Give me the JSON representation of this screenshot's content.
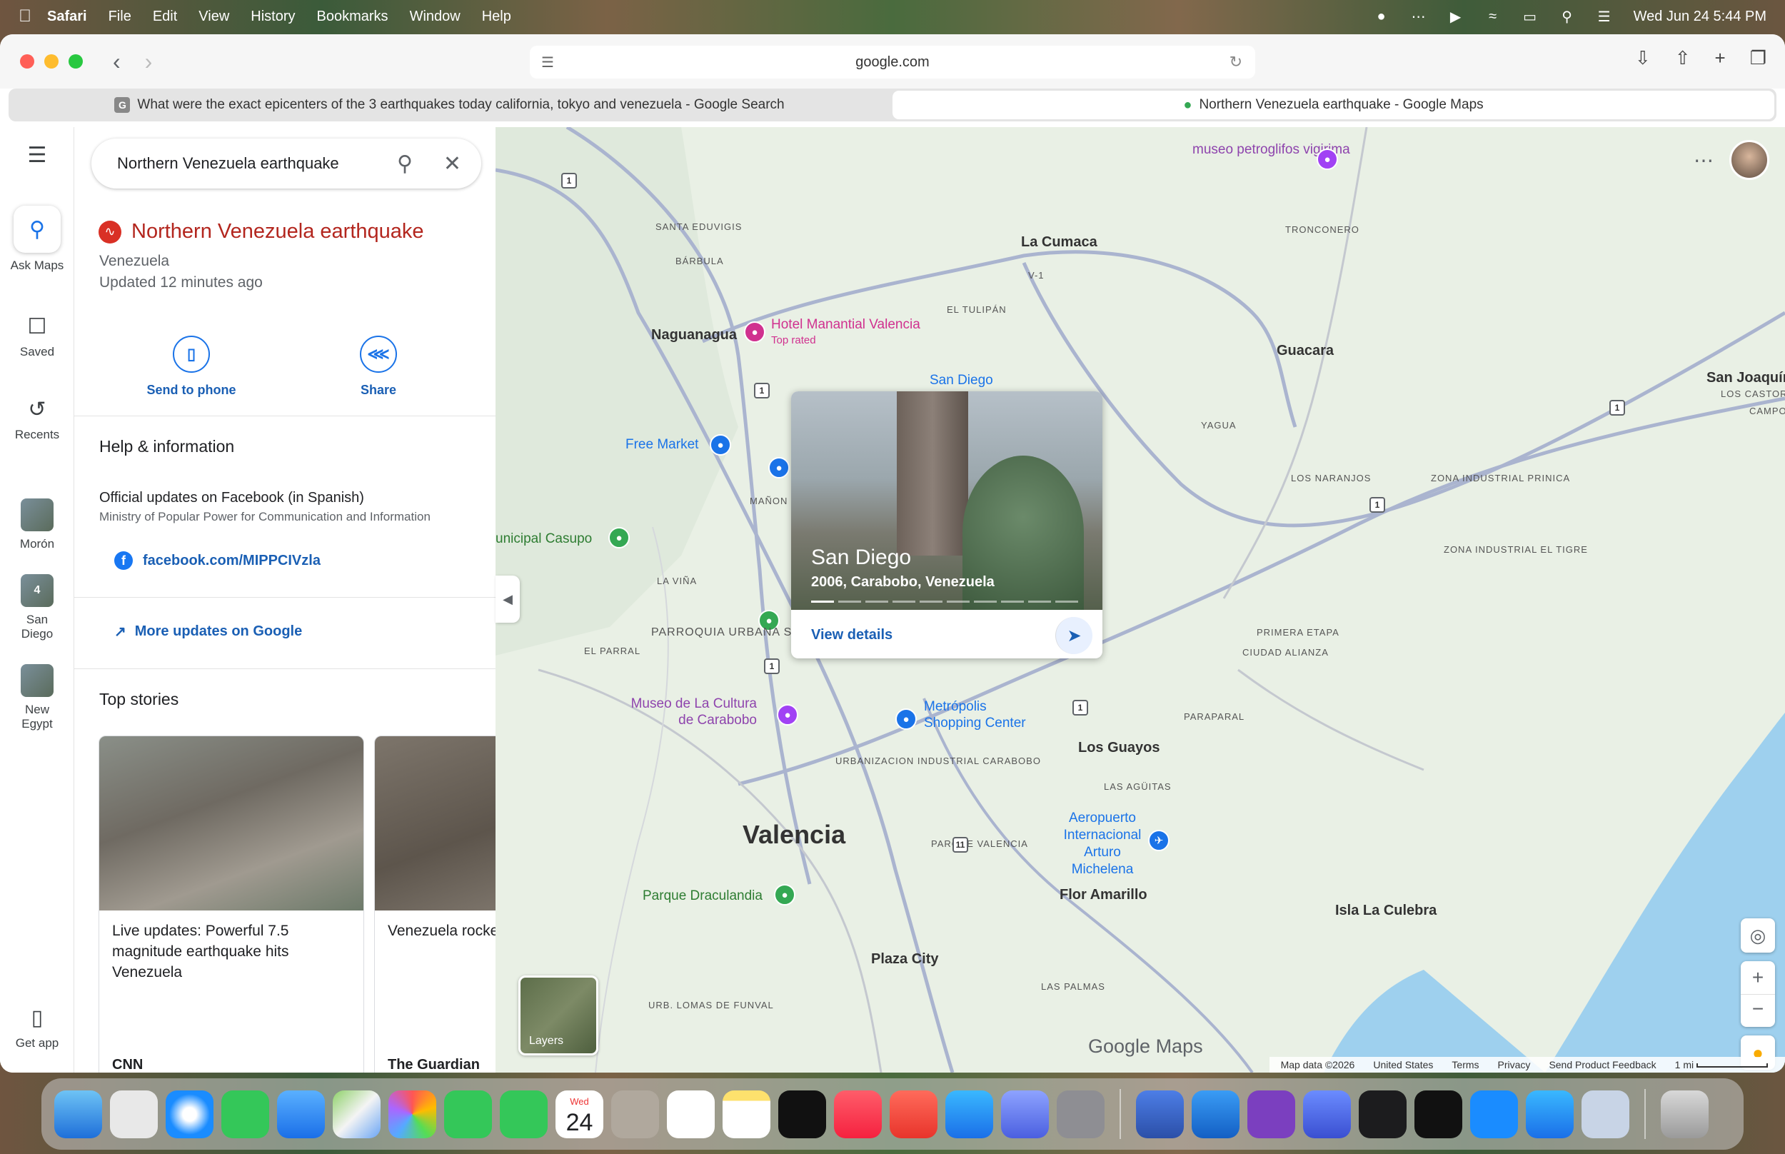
{
  "menubar": {
    "app": "Safari",
    "items": [
      "File",
      "Edit",
      "View",
      "History",
      "Bookmarks",
      "Window",
      "Help"
    ],
    "datetime": "Wed Jun 24  5:44 PM"
  },
  "toolbar": {
    "url": "google.com"
  },
  "tabs": [
    {
      "favicon": "G",
      "title": "What were the exact epicenters of the 3 earthquakes today california, tokyo and venezuela - Google Search"
    },
    {
      "favicon": "maps-pin",
      "title": "Northern Venezuela earthquake - Google Maps"
    }
  ],
  "rail": {
    "ask_maps": "Ask Maps",
    "saved": "Saved",
    "recents": "Recents",
    "recent_places": [
      "Morón",
      "San Diego",
      "New Egypt"
    ],
    "san_diego_badge": "4",
    "get_app": "Get app"
  },
  "search": {
    "value": "Northern Venezuela earthquake"
  },
  "alert": {
    "title": "Northern Venezuela earthquake",
    "region": "Venezuela",
    "updated": "Updated 12 minutes ago"
  },
  "actions": {
    "send_to_phone": "Send to phone",
    "share": "Share"
  },
  "help": {
    "heading": "Help & information",
    "official_title": "Official updates on Facebook (in Spanish)",
    "official_sub": "Ministry of Popular Power for Communication and Information",
    "facebook_link": "facebook.com/MIPPCIVzla",
    "more_updates": "More updates on Google"
  },
  "top_stories": {
    "heading": "Top stories",
    "stories": [
      {
        "title": "Live updates: Powerful 7.5 magnitude earthquake hits Venezuela",
        "source": "CNN"
      },
      {
        "title": "Venezuela rocke back-to-back ea",
        "source": "The Guardian"
      }
    ]
  },
  "map": {
    "popup": {
      "title": "San Diego",
      "subtitle": "2006, Carabobo, Venezuela",
      "view_details": "View details"
    },
    "labels": {
      "museo_petroglifos": "museo petroglifos vigirima",
      "santa_eduvigis": "SANTA EDUVIGIS",
      "barbula": "BÁRBULA",
      "la_cumaca": "La Cumaca",
      "tronconero": "TRONCONERO",
      "el_tulipan": "EL TULIPÁN",
      "naguanagua": "Naguanagua",
      "hotel": "Hotel Manantial Valencia",
      "hotel_sub": "Top rated",
      "guacara": "Guacara",
      "san_joaquin": "San Joaquín",
      "los_castor": "LOS CASTOR",
      "campo_alegre": "CAMPO ALEGRE",
      "san_diego_map": "San Diego",
      "free_market": "Free Market",
      "yagua": "YAGUA",
      "los_naranjos": "LOS NARANJOS",
      "zona_prinica": "ZONA INDUSTRIAL PRINICA",
      "manon": "MAÑON",
      "casupo": "unicipal Casupo",
      "zona_tigre": "ZONA INDUSTRIAL EL TIGRE",
      "la_vina": "LA VIÑA",
      "primera_etapa": "PRIMERA ETAPA",
      "ciudad_alianza": "CIUDAD ALIANZA",
      "el_parral": "EL PARRAL",
      "parroquia": "PARROQUIA URBANA SAN JOSÉ",
      "museo_cultura": "Museo de La Cultura de Carabobo",
      "metropolis": "Metrópolis Shopping Center",
      "paraparal": "PARAPARAL",
      "los_guayos": "Los Guayos",
      "urbanizacion": "URBANIZACION INDUSTRIAL CARABOBO",
      "las_aguitas": "LAS AGÜITAS",
      "valencia": "Valencia",
      "aeropuerto": "Aeropuerto Internacional Arturo Michelena",
      "parque_valencia": "PARQUE VALENCIA",
      "parque_draculandia": "Parque Draculandia",
      "flor_amarillo": "Flor Amarillo",
      "isla_culebra": "Isla La Culebra",
      "plaza_city": "Plaza City",
      "las_palmas": "LAS PALMAS",
      "lomas_funval": "URB. LOMAS DE FUNVAL",
      "v1": "V-1"
    },
    "route_shields": [
      "1",
      "1",
      "1",
      "1",
      "1",
      "1",
      "11"
    ],
    "layers": "Layers",
    "brand": "Google Maps",
    "footer": {
      "map_data": "Map data ©2026",
      "country": "United States",
      "terms": "Terms",
      "privacy": "Privacy",
      "feedback": "Send Product Feedback",
      "scale": "1 mi"
    }
  },
  "dock": {
    "calendar_month": "Wed",
    "calendar_day": "24"
  },
  "colors": {
    "accent": "#1a73e8",
    "alert_red": "#b3261e",
    "water": "#9ed0ee"
  }
}
